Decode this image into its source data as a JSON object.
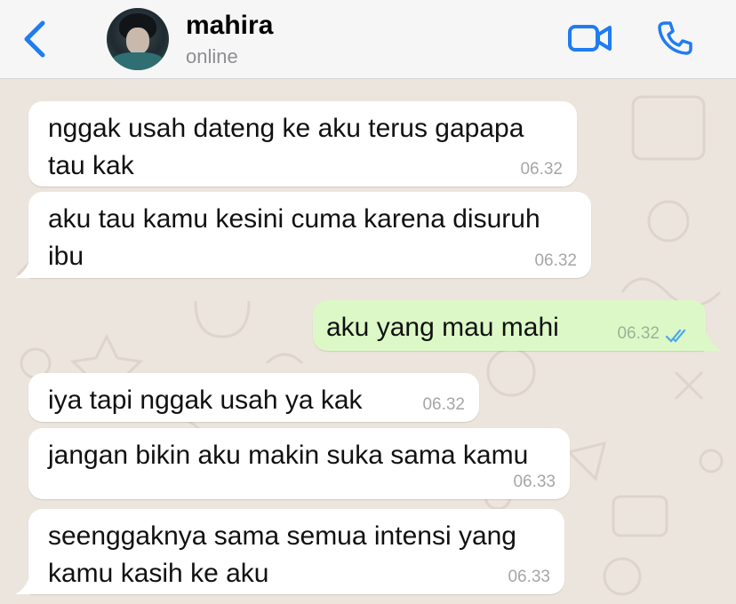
{
  "header": {
    "contact_name": "mahira",
    "status": "online",
    "icons": {
      "back": "chevron-left-icon",
      "video": "video-call-icon",
      "phone": "phone-icon"
    },
    "accent_color": "#1f7cf1"
  },
  "messages": [
    {
      "direction": "incoming",
      "lines": [
        "nggak usah dateng ke aku terus gapapa",
        "tau kak"
      ],
      "time": "06.32"
    },
    {
      "direction": "incoming",
      "lines": [
        "aku tau kamu kesini cuma karena disuruh",
        "ibu"
      ],
      "time": "06.32"
    },
    {
      "direction": "outgoing",
      "lines": [
        "aku yang mau mahi"
      ],
      "time": "06.32",
      "read": true
    },
    {
      "direction": "incoming",
      "lines": [
        "iya tapi nggak usah ya kak"
      ],
      "time": "06.32"
    },
    {
      "direction": "incoming",
      "lines": [
        "jangan bikin aku makin suka sama kamu"
      ],
      "time": "06.33"
    },
    {
      "direction": "incoming",
      "lines": [
        "seenggaknya sama semua intensi yang",
        "kamu kasih ke aku"
      ],
      "time": "06.33"
    }
  ],
  "colors": {
    "incoming_bubble": "#ffffff",
    "outgoing_bubble": "#dcf8c6",
    "read_ticks": "#4fa8e8",
    "wallpaper": "#ece5dd"
  }
}
